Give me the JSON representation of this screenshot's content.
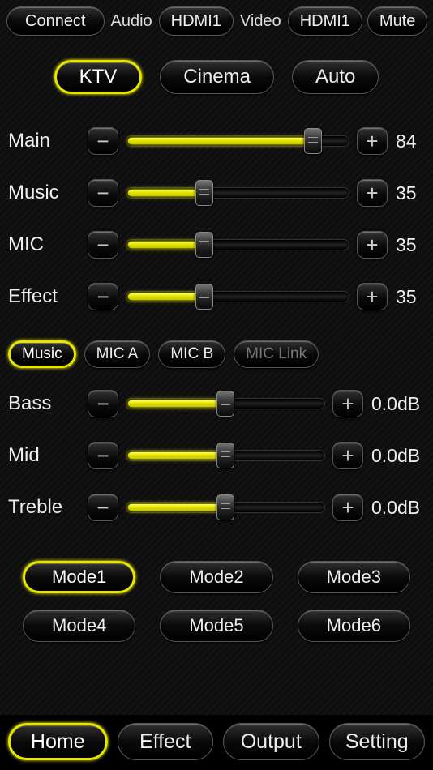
{
  "top": {
    "connect": "Connect",
    "audio_label": "Audio",
    "audio_value": "HDMI1",
    "video_label": "Video",
    "video_value": "HDMI1",
    "mute": "Mute"
  },
  "modes": {
    "ktv": "KTV",
    "cinema": "Cinema",
    "auto": "Auto",
    "active": "ktv"
  },
  "main_sliders": [
    {
      "key": "main",
      "label": "Main",
      "value": 84,
      "display": "84",
      "pct": 84
    },
    {
      "key": "music",
      "label": "Music",
      "value": 35,
      "display": "35",
      "pct": 35
    },
    {
      "key": "mic",
      "label": "MIC",
      "value": 35,
      "display": "35",
      "pct": 35
    },
    {
      "key": "effect",
      "label": "Effect",
      "value": 35,
      "display": "35",
      "pct": 35
    }
  ],
  "sub_tabs": {
    "items": [
      {
        "key": "music",
        "label": "Music"
      },
      {
        "key": "mica",
        "label": "MIC A"
      },
      {
        "key": "micb",
        "label": "MIC B"
      },
      {
        "key": "miclink",
        "label": "MIC Link"
      }
    ],
    "active": "music",
    "dim": "miclink"
  },
  "eq_sliders": [
    {
      "key": "bass",
      "label": "Bass",
      "display": "0.0dB",
      "pct": 50
    },
    {
      "key": "mid",
      "label": "Mid",
      "display": "0.0dB",
      "pct": 50
    },
    {
      "key": "treble",
      "label": "Treble",
      "display": "0.0dB",
      "pct": 50
    }
  ],
  "presets": {
    "items": [
      {
        "key": "mode1",
        "label": "Mode1"
      },
      {
        "key": "mode2",
        "label": "Mode2"
      },
      {
        "key": "mode3",
        "label": "Mode3"
      },
      {
        "key": "mode4",
        "label": "Mode4"
      },
      {
        "key": "mode5",
        "label": "Mode5"
      },
      {
        "key": "mode6",
        "label": "Mode6"
      }
    ],
    "active": "mode1"
  },
  "nav": {
    "items": [
      {
        "key": "home",
        "label": "Home"
      },
      {
        "key": "effect",
        "label": "Effect"
      },
      {
        "key": "output",
        "label": "Output"
      },
      {
        "key": "setting",
        "label": "Setting"
      }
    ],
    "active": "home"
  },
  "icons": {
    "minus": "−",
    "plus": "+"
  }
}
